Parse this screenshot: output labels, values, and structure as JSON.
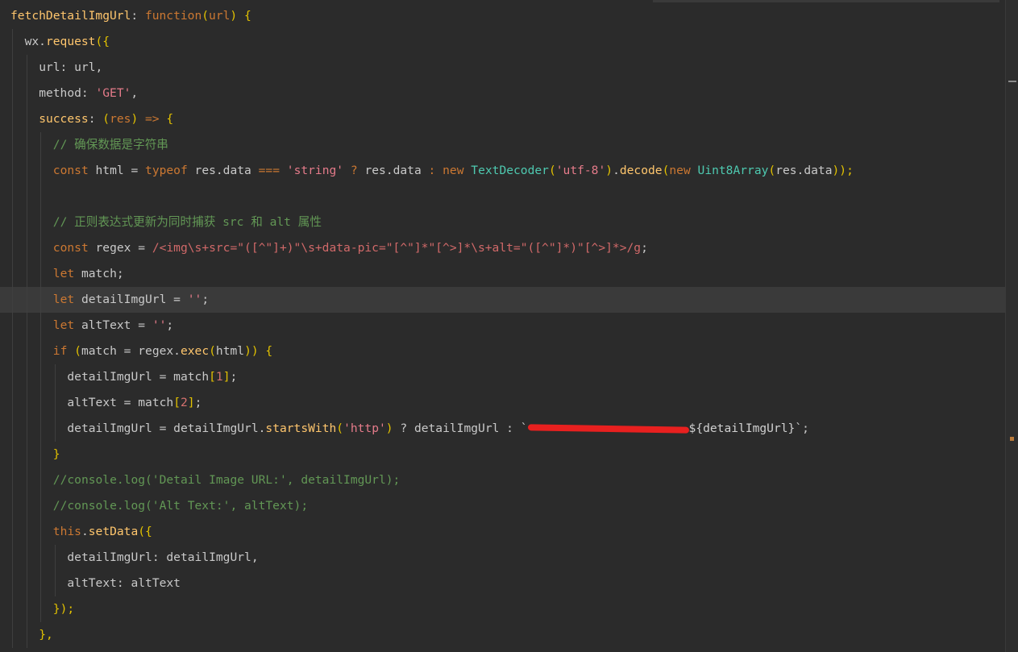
{
  "editor": {
    "lines": [
      {
        "indent": 0,
        "tokens": [
          {
            "t": "fetchDetailImgUrl",
            "c": "fn"
          },
          {
            "t": ": ",
            "c": "p"
          },
          {
            "t": "function",
            "c": "k"
          },
          {
            "t": "(",
            "c": "br"
          },
          {
            "t": "url",
            "c": "k"
          },
          {
            "t": ") {",
            "c": "br"
          }
        ]
      },
      {
        "indent": 1,
        "tokens": [
          {
            "t": "wx",
            "c": "p"
          },
          {
            "t": ".",
            "c": "p"
          },
          {
            "t": "request",
            "c": "fn"
          },
          {
            "t": "({",
            "c": "br"
          }
        ]
      },
      {
        "indent": 2,
        "tokens": [
          {
            "t": "url",
            "c": "p"
          },
          {
            "t": ": ",
            "c": "p"
          },
          {
            "t": "url",
            "c": "p"
          },
          {
            "t": ",",
            "c": "p"
          }
        ]
      },
      {
        "indent": 2,
        "tokens": [
          {
            "t": "method",
            "c": "p"
          },
          {
            "t": ": ",
            "c": "p"
          },
          {
            "t": "'GET'",
            "c": "s"
          },
          {
            "t": ",",
            "c": "p"
          }
        ]
      },
      {
        "indent": 2,
        "tokens": [
          {
            "t": "success",
            "c": "fn"
          },
          {
            "t": ": ",
            "c": "p"
          },
          {
            "t": "(",
            "c": "br"
          },
          {
            "t": "res",
            "c": "k"
          },
          {
            "t": ") ",
            "c": "br"
          },
          {
            "t": "=>",
            "c": "k"
          },
          {
            "t": " {",
            "c": "br"
          }
        ]
      },
      {
        "indent": 3,
        "tokens": [
          {
            "t": "// 确保数据是字符串",
            "c": "c"
          }
        ]
      },
      {
        "indent": 3,
        "tokens": [
          {
            "t": "const",
            "c": "k"
          },
          {
            "t": " html = ",
            "c": "p"
          },
          {
            "t": "typeof",
            "c": "k"
          },
          {
            "t": " res.data ",
            "c": "p"
          },
          {
            "t": "===",
            "c": "k"
          },
          {
            "t": " ",
            "c": "p"
          },
          {
            "t": "'string'",
            "c": "s"
          },
          {
            "t": " ",
            "c": "p"
          },
          {
            "t": "?",
            "c": "k"
          },
          {
            "t": " res.data ",
            "c": "p"
          },
          {
            "t": ":",
            "c": "k"
          },
          {
            "t": " ",
            "c": "p"
          },
          {
            "t": "new",
            "c": "k"
          },
          {
            "t": " ",
            "c": "p"
          },
          {
            "t": "TextDecoder",
            "c": "type"
          },
          {
            "t": "(",
            "c": "br"
          },
          {
            "t": "'utf-8'",
            "c": "s"
          },
          {
            "t": ")",
            "c": "br"
          },
          {
            "t": ".",
            "c": "p"
          },
          {
            "t": "decode",
            "c": "fn"
          },
          {
            "t": "(",
            "c": "br"
          },
          {
            "t": "new",
            "c": "k"
          },
          {
            "t": " ",
            "c": "p"
          },
          {
            "t": "Uint8Array",
            "c": "type"
          },
          {
            "t": "(",
            "c": "br"
          },
          {
            "t": "res.data",
            "c": "p"
          },
          {
            "t": "));",
            "c": "br"
          }
        ]
      },
      {
        "indent": 3,
        "tokens": []
      },
      {
        "indent": 3,
        "tokens": [
          {
            "t": "// 正则表达式更新为同时捕获 src 和 alt 属性",
            "c": "c"
          }
        ]
      },
      {
        "indent": 3,
        "tokens": [
          {
            "t": "const",
            "c": "k"
          },
          {
            "t": " regex = ",
            "c": "p"
          },
          {
            "t": "/<img\\s+src=\"([^\"]+)\"\\s+data-pic=\"[^\"]*\"[^>]*\\s+alt=\"([^\"]*)\"[^>]*>/g",
            "c": "re"
          },
          {
            "t": ";",
            "c": "p"
          }
        ]
      },
      {
        "indent": 3,
        "tokens": [
          {
            "t": "let",
            "c": "k"
          },
          {
            "t": " match;",
            "c": "p"
          }
        ]
      },
      {
        "indent": 3,
        "current": true,
        "tokens": [
          {
            "t": "let",
            "c": "k"
          },
          {
            "t": " detailImgUrl = ",
            "c": "p"
          },
          {
            "t": "''",
            "c": "s"
          },
          {
            "t": ";",
            "c": "p"
          }
        ]
      },
      {
        "indent": 3,
        "tokens": [
          {
            "t": "let",
            "c": "k"
          },
          {
            "t": " altText = ",
            "c": "p"
          },
          {
            "t": "''",
            "c": "s"
          },
          {
            "t": ";",
            "c": "p"
          }
        ]
      },
      {
        "indent": 3,
        "tokens": [
          {
            "t": "if",
            "c": "k"
          },
          {
            "t": " (",
            "c": "br"
          },
          {
            "t": "match = regex.",
            "c": "p"
          },
          {
            "t": "exec",
            "c": "fn"
          },
          {
            "t": "(",
            "c": "br"
          },
          {
            "t": "html",
            "c": "p"
          },
          {
            "t": ")) {",
            "c": "br"
          }
        ]
      },
      {
        "indent": 4,
        "tokens": [
          {
            "t": "detailImgUrl = match",
            "c": "p"
          },
          {
            "t": "[",
            "c": "br"
          },
          {
            "t": "1",
            "c": "num"
          },
          {
            "t": "]",
            "c": "br"
          },
          {
            "t": ";",
            "c": "p"
          }
        ]
      },
      {
        "indent": 4,
        "tokens": [
          {
            "t": "altText = match",
            "c": "p"
          },
          {
            "t": "[",
            "c": "br"
          },
          {
            "t": "2",
            "c": "num"
          },
          {
            "t": "]",
            "c": "br"
          },
          {
            "t": ";",
            "c": "p"
          }
        ]
      },
      {
        "indent": 4,
        "tokens": [
          {
            "t": "detailImgUrl = detailImgUrl.",
            "c": "p"
          },
          {
            "t": "startsWith",
            "c": "fn"
          },
          {
            "t": "(",
            "c": "br"
          },
          {
            "t": "'http'",
            "c": "s"
          },
          {
            "t": ")",
            "c": "br"
          },
          {
            "t": " ? detailImgUrl : `",
            "c": "p"
          },
          {
            "t": "",
            "c": "redact"
          },
          {
            "t": "${detailImgUrl}`",
            "c": "tmpl"
          },
          {
            "t": ";",
            "c": "p"
          }
        ]
      },
      {
        "indent": 3,
        "tokens": [
          {
            "t": "}",
            "c": "br"
          }
        ]
      },
      {
        "indent": 3,
        "tokens": [
          {
            "t": "//console.log('Detail Image URL:', detailImgUrl);",
            "c": "c"
          }
        ]
      },
      {
        "indent": 3,
        "tokens": [
          {
            "t": "//console.log('Alt Text:', altText);",
            "c": "c"
          }
        ]
      },
      {
        "indent": 3,
        "tokens": [
          {
            "t": "this",
            "c": "k"
          },
          {
            "t": ".",
            "c": "p"
          },
          {
            "t": "setData",
            "c": "fn"
          },
          {
            "t": "({",
            "c": "br"
          }
        ]
      },
      {
        "indent": 4,
        "tokens": [
          {
            "t": "detailImgUrl: detailImgUrl,",
            "c": "p"
          }
        ]
      },
      {
        "indent": 4,
        "tokens": [
          {
            "t": "altText: altText",
            "c": "p"
          }
        ]
      },
      {
        "indent": 3,
        "tokens": [
          {
            "t": "});",
            "c": "br"
          }
        ]
      },
      {
        "indent": 2,
        "tokens": [
          {
            "t": "},",
            "c": "br"
          }
        ]
      }
    ]
  },
  "colors": {
    "background": "#2b2b2b",
    "current_line": "#3a3a3a",
    "keyword": "#cc7832",
    "function": "#ffc66d",
    "string": "#e57b8a",
    "comment": "#629755",
    "redaction": "#e8201f"
  }
}
